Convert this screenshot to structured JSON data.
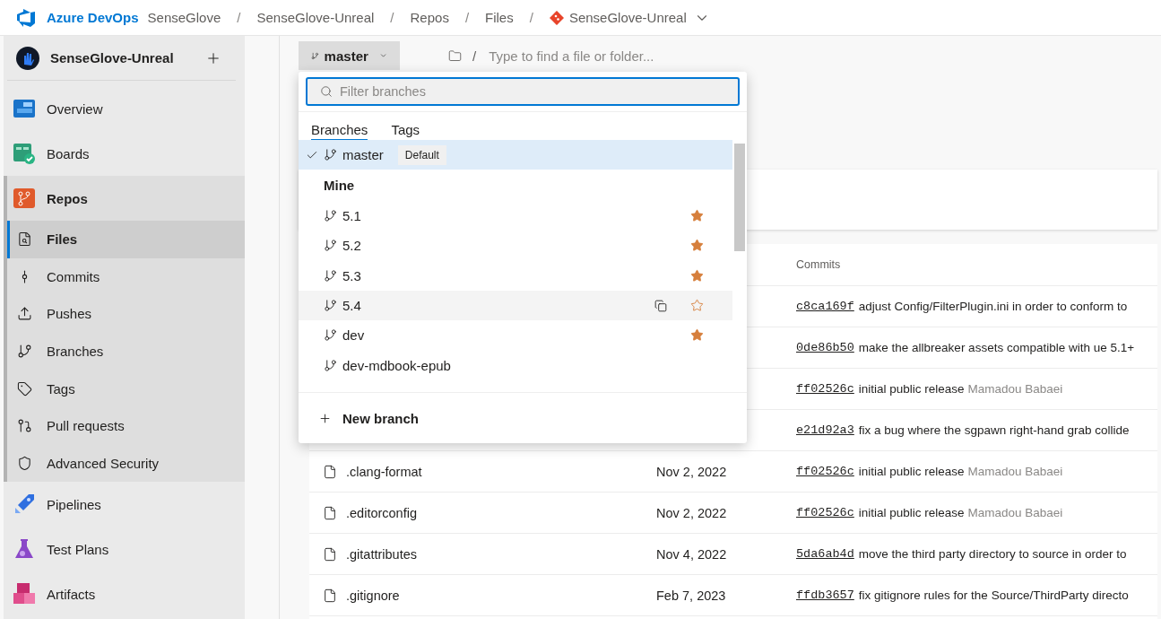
{
  "breadcrumb": {
    "product": "Azure DevOps",
    "items": [
      {
        "label": "SenseGlove"
      },
      {
        "separator": "/",
        "label": "SenseGlove-Unreal"
      },
      {
        "separator": "/",
        "label": "Repos"
      },
      {
        "separator": "/",
        "label": "Files"
      }
    ],
    "repo": {
      "separator": "/",
      "label": "SenseGlove-Unreal"
    }
  },
  "sidebar": {
    "project": "SenseGlove-Unreal",
    "items": [
      {
        "label": "Overview",
        "selected": false
      },
      {
        "label": "Boards",
        "selected": false
      },
      {
        "label": "Repos",
        "selected": true,
        "children": [
          {
            "label": "Files",
            "selected": true
          },
          {
            "label": "Commits",
            "selected": false
          },
          {
            "label": "Pushes",
            "selected": false
          },
          {
            "label": "Branches",
            "selected": false
          },
          {
            "label": "Tags",
            "selected": false
          },
          {
            "label": "Pull requests",
            "selected": false
          },
          {
            "label": "Advanced Security",
            "selected": false
          }
        ]
      },
      {
        "label": "Pipelines",
        "selected": false
      },
      {
        "label": "Test Plans",
        "selected": false
      },
      {
        "label": "Artifacts",
        "selected": false
      }
    ]
  },
  "toolbar": {
    "branch": "master",
    "path_separator": "/",
    "path_placeholder": "Type to find a file or folder..."
  },
  "branch_menu": {
    "filter_placeholder": "Filter branches",
    "tabs": [
      {
        "label": "Branches",
        "selected": true
      },
      {
        "label": "Tags",
        "selected": false
      }
    ],
    "current": {
      "name": "master",
      "badge": "Default",
      "checked": true
    },
    "section": "Mine",
    "branches": [
      {
        "name": "5.1",
        "starred": true,
        "hovered": false
      },
      {
        "name": "5.2",
        "starred": true,
        "hovered": false
      },
      {
        "name": "5.3",
        "starred": true,
        "hovered": false
      },
      {
        "name": "5.4",
        "starred": false,
        "hovered": true
      },
      {
        "name": "dev",
        "starred": true,
        "hovered": false
      },
      {
        "name": "dev-mdbook-epub",
        "starred": false,
        "hovered": false
      }
    ],
    "new_branch": "New branch"
  },
  "files": {
    "columns": [
      {
        "label": "Commits"
      }
    ],
    "rows": [
      {
        "hash": "c8ca169f",
        "message": "adjust Config/FilterPlugin.ini in order to conform to"
      },
      {
        "hash": "0de86b50",
        "message": "make the allbreaker assets compatible with ue 5.1+"
      },
      {
        "hash": "ff02526c",
        "message": "initial public release",
        "author": "Mamadou Babaei"
      },
      {
        "hash": "e21d92a3",
        "message": "fix a bug where the sgpawn right-hand grab collide"
      },
      {
        "name": ".clang-format",
        "date": "Nov 2, 2022",
        "hash": "ff02526c",
        "message": "initial public release",
        "author": "Mamadou Babaei"
      },
      {
        "name": ".editorconfig",
        "date": "Nov 2, 2022",
        "hash": "ff02526c",
        "message": "initial public release",
        "author": "Mamadou Babaei"
      },
      {
        "name": ".gitattributes",
        "date": "Nov 4, 2022",
        "hash": "5da6ab4d",
        "message": "move the third party directory to source in order to"
      },
      {
        "name": ".gitignore",
        "date": "Feb 7, 2023",
        "hash": "ffdb3657",
        "message": "fix gitignore rules for the Source/ThirdParty directo"
      }
    ]
  }
}
